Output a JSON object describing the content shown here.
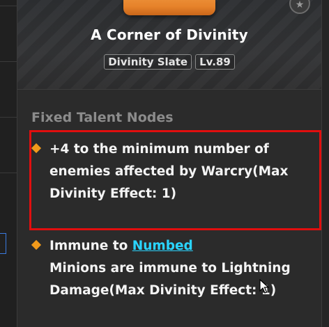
{
  "item": {
    "name": "A Corner of Divinity",
    "type_tag": "Divinity Slate",
    "level_tag": "Lv.89"
  },
  "fixed_talent_nodes": {
    "title": "Fixed Talent Nodes",
    "nodes": [
      {
        "text": "+4 to the minimum number of enemies affected by Warcry(Max Divinity Effect: 1)"
      },
      {
        "prefix": "Immune to ",
        "link": "Numbed",
        "line2": "Minions are immune to Lightning Damage(Max Divinity Effect: 1)"
      }
    ]
  },
  "colors": {
    "accent_orange": "#f19a1b",
    "link_cyan": "#2ad4ff",
    "highlight_red": "#e10e0e"
  },
  "icons": [
    "diamond-bullet-icon",
    "lock-badge-icon",
    "mouse-cursor-icon"
  ]
}
